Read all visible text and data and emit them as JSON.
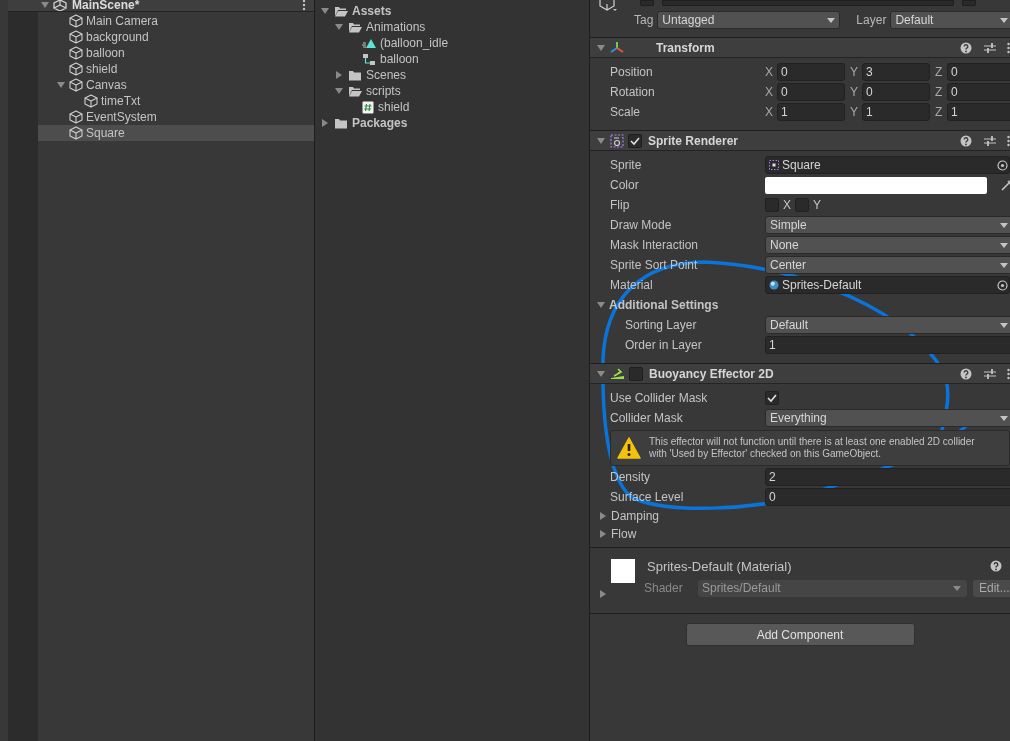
{
  "hierarchy": {
    "scene": {
      "label": "MainScene*",
      "expanded": true
    },
    "items": [
      {
        "label": "Main Camera",
        "selected": false
      },
      {
        "label": "background",
        "selected": false
      },
      {
        "label": "balloon",
        "selected": false
      },
      {
        "label": "shield",
        "selected": false
      },
      {
        "label": "Canvas",
        "selected": false,
        "expanded": true,
        "children": [
          {
            "label": "timeTxt",
            "selected": false
          }
        ]
      },
      {
        "label": "EventSystem",
        "selected": false
      },
      {
        "label": "Square",
        "selected": true
      }
    ]
  },
  "project": {
    "items": [
      {
        "label": "Assets",
        "kind": "folder",
        "expanded": true,
        "children": [
          {
            "label": "Animations",
            "kind": "folder",
            "expanded": true,
            "children": [
              {
                "label": "(balloon_idle",
                "kind": "clip"
              },
              {
                "label": "balloon",
                "kind": "controller"
              }
            ]
          },
          {
            "label": "Scenes",
            "kind": "folder",
            "expanded": false
          },
          {
            "label": "scripts",
            "kind": "folder",
            "expanded": true,
            "children": [
              {
                "label": "shield",
                "kind": "script"
              }
            ]
          }
        ]
      },
      {
        "label": "Packages",
        "kind": "folder",
        "expanded": false
      }
    ]
  },
  "inspector": {
    "tag_label": "Tag",
    "tag": "Untagged",
    "layer_label": "Layer",
    "layer": "Default",
    "components": [
      {
        "kind": "transform",
        "title": "Transform",
        "expanded": true,
        "fields": [
          {
            "kind": "vector",
            "label": "Position",
            "axes": [
              {
                "axis": "X",
                "value": "0"
              },
              {
                "axis": "Y",
                "value": "3"
              },
              {
                "axis": "Z",
                "value": "0"
              }
            ]
          },
          {
            "kind": "vector",
            "label": "Rotation",
            "axes": [
              {
                "axis": "X",
                "value": "0"
              },
              {
                "axis": "Y",
                "value": "0"
              },
              {
                "axis": "Z",
                "value": "0"
              }
            ]
          },
          {
            "kind": "vector",
            "label": "Scale",
            "axes": [
              {
                "axis": "X",
                "value": "1"
              },
              {
                "axis": "Y",
                "value": "1"
              },
              {
                "axis": "Z",
                "value": "1"
              }
            ]
          }
        ]
      },
      {
        "kind": "sprite_renderer",
        "title": "Sprite Renderer",
        "expanded": true,
        "enabled": true,
        "fields": [
          {
            "kind": "sprite_object",
            "label": "Sprite",
            "value": "Square"
          },
          {
            "kind": "color",
            "label": "Color",
            "color": "#ffffff"
          },
          {
            "kind": "flip",
            "label": "Flip",
            "options": [
              {
                "label": "X",
                "checked": false
              },
              {
                "label": "Y",
                "checked": false
              }
            ]
          },
          {
            "kind": "dropdown",
            "label": "Draw Mode",
            "value": "Simple"
          },
          {
            "kind": "dropdown",
            "label": "Mask Interaction",
            "value": "None"
          },
          {
            "kind": "dropdown",
            "label": "Sprite Sort Point",
            "value": "Center"
          },
          {
            "kind": "material_object",
            "label": "Material",
            "value": "Sprites-Default"
          },
          {
            "kind": "section",
            "label": "Additional Settings",
            "expanded": true,
            "children": [
              {
                "kind": "dropdown",
                "label": "Sorting Layer",
                "value": "Default"
              },
              {
                "kind": "number",
                "label": "Order in Layer",
                "value": "1"
              }
            ]
          }
        ]
      },
      {
        "kind": "effector",
        "title": "Buoyancy Effector 2D",
        "expanded": true,
        "enabled": false,
        "fields": [
          {
            "kind": "checkbox",
            "label": "Use Collider Mask",
            "checked": true
          },
          {
            "kind": "dropdown",
            "label": "Collider Mask",
            "value": "Everything"
          },
          {
            "kind": "warning",
            "text": "This effector will not function until there is at least one enabled 2D collider\nwith 'Used by Effector' checked on this GameObject."
          },
          {
            "kind": "number",
            "label": "Density",
            "value": "2"
          },
          {
            "kind": "number",
            "label": "Surface Level",
            "value": "0"
          },
          {
            "kind": "foldout",
            "label": "Damping",
            "expanded": false
          },
          {
            "kind": "foldout",
            "label": "Flow",
            "expanded": false
          }
        ]
      }
    ],
    "material": {
      "title": "Sprites-Default (Material)",
      "shader_label": "Shader",
      "shader": "Sprites/Default",
      "edit": "Edit...",
      "expanded": false
    },
    "add_button": "Add Component"
  }
}
